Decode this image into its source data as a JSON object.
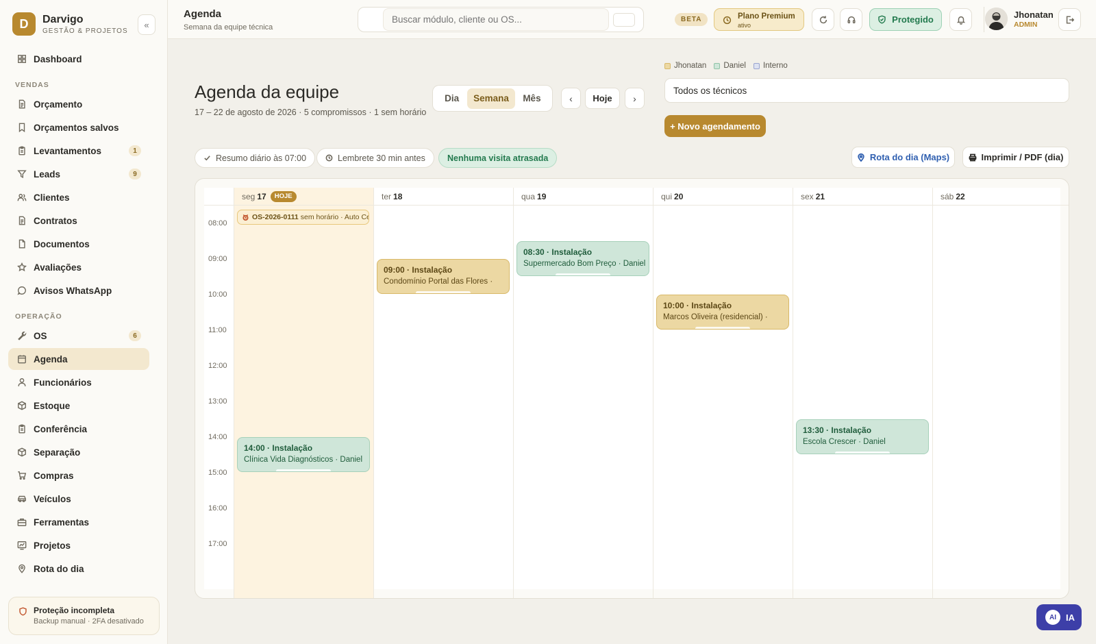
{
  "brand": {
    "logo_letter": "D",
    "name": "Darvigo",
    "subtitle": "GESTÃO & PROJETOS",
    "collapse_glyph": "«"
  },
  "sidebar": {
    "items": [
      {
        "label": "Dashboard",
        "icon": "grid-icon"
      },
      {
        "section": "VENDAS"
      },
      {
        "label": "Orçamento",
        "icon": "document-icon"
      },
      {
        "label": "Orçamentos salvos",
        "icon": "bookmark-icon"
      },
      {
        "label": "Levantamentos",
        "icon": "clipboard-icon",
        "badge": "1"
      },
      {
        "label": "Leads",
        "icon": "filter-icon",
        "badge": "9"
      },
      {
        "label": "Clientes",
        "icon": "users-icon"
      },
      {
        "label": "Contratos",
        "icon": "document-icon"
      },
      {
        "label": "Documentos",
        "icon": "file-icon"
      },
      {
        "label": "Avaliações",
        "icon": "star-icon"
      },
      {
        "label": "Avisos WhatsApp",
        "icon": "chat-icon"
      },
      {
        "section": "OPERAÇÃO"
      },
      {
        "label": "OS",
        "icon": "wrench-icon",
        "badge": "6"
      },
      {
        "label": "Agenda",
        "icon": "calendar-icon",
        "active": true
      },
      {
        "label": "Funcionários",
        "icon": "user-icon"
      },
      {
        "label": "Estoque",
        "icon": "box-icon"
      },
      {
        "label": "Conferência",
        "icon": "clipboard-icon"
      },
      {
        "label": "Separação",
        "icon": "box-icon"
      },
      {
        "label": "Compras",
        "icon": "cart-icon"
      },
      {
        "label": "Veículos",
        "icon": "car-icon"
      },
      {
        "label": "Ferramentas",
        "icon": "toolbox-icon"
      },
      {
        "label": "Projetos",
        "icon": "chart-icon"
      },
      {
        "label": "Rota do dia",
        "icon": "pin-icon"
      }
    ],
    "protection": {
      "title": "Proteção incompleta",
      "subtitle": "Backup manual · 2FA desativado"
    }
  },
  "topbar": {
    "title": "Agenda",
    "subtitle": "Semana da equipe técnica",
    "search_placeholder": "Buscar módulo, cliente ou OS...",
    "beta": "BETA",
    "premium_title": "Plano Premium",
    "premium_sub": "ativo",
    "protected": "Protegido",
    "user_name": "Jhonatan",
    "user_role": "ADMIN"
  },
  "main": {
    "title": "Agenda da equipe",
    "subtitle": "17 – 22 de agosto de 2026 · 5 compromissos · 1 sem horário",
    "views": [
      "Dia",
      "Semana",
      "Mês"
    ],
    "active_view": "Semana",
    "prev": "‹",
    "today": "Hoje",
    "next": "›",
    "legend": [
      {
        "label": "Jhonatan",
        "color": "#ecd8a3",
        "border": "#d8b868"
      },
      {
        "label": "Daniel",
        "color": "#cfe6d9",
        "border": "#8fc3a6"
      },
      {
        "label": "Interno",
        "color": "#dde2f2",
        "border": "#9aa4cf"
      }
    ],
    "technician_filter": "Todos os técnicos",
    "new_button": "+ Novo agendamento",
    "chips": [
      "Resumo diário às 07:00",
      "Lembrete 30 min antes",
      "Nenhuma visita atrasada"
    ],
    "route_button": "Rota do dia (Maps)",
    "print_button": "Imprimir / PDF (dia)",
    "ai_label": "IA",
    "ai_badge": "AI"
  },
  "calendar": {
    "today_tag": "HOJE",
    "days": [
      {
        "dow": "seg",
        "day": "17",
        "today": true
      },
      {
        "dow": "ter",
        "day": "18"
      },
      {
        "dow": "qua",
        "day": "19"
      },
      {
        "dow": "qui",
        "day": "20"
      },
      {
        "dow": "sex",
        "day": "21"
      },
      {
        "dow": "sáb",
        "day": "22"
      }
    ],
    "hours": [
      "08:00",
      "09:00",
      "10:00",
      "11:00",
      "12:00",
      "13:00",
      "14:00",
      "15:00",
      "16:00",
      "17:00"
    ],
    "unscheduled": {
      "code": "OS-2026-0111",
      "text": "sem horário · Auto Ce"
    },
    "events": [
      {
        "day": 0,
        "start": "14:00",
        "title": "14:00 · Instalação",
        "sub": "Clínica Vida Diagnósticos · Daniel",
        "tech": "green"
      },
      {
        "day": 1,
        "start": "09:00",
        "title": "09:00 · Instalação",
        "sub": "Condomínio Portal das Flores ·",
        "tech": "gold"
      },
      {
        "day": 2,
        "start": "08:30",
        "title": "08:30 · Instalação",
        "sub": "Supermercado Bom Preço · Daniel",
        "tech": "green"
      },
      {
        "day": 3,
        "start": "10:00",
        "title": "10:00 · Instalação",
        "sub": "Marcos Oliveira (residencial) ·",
        "tech": "gold"
      },
      {
        "day": 4,
        "start": "13:30",
        "title": "13:30 · Instalação",
        "sub": "Escola Crescer · Daniel",
        "tech": "green"
      }
    ]
  }
}
